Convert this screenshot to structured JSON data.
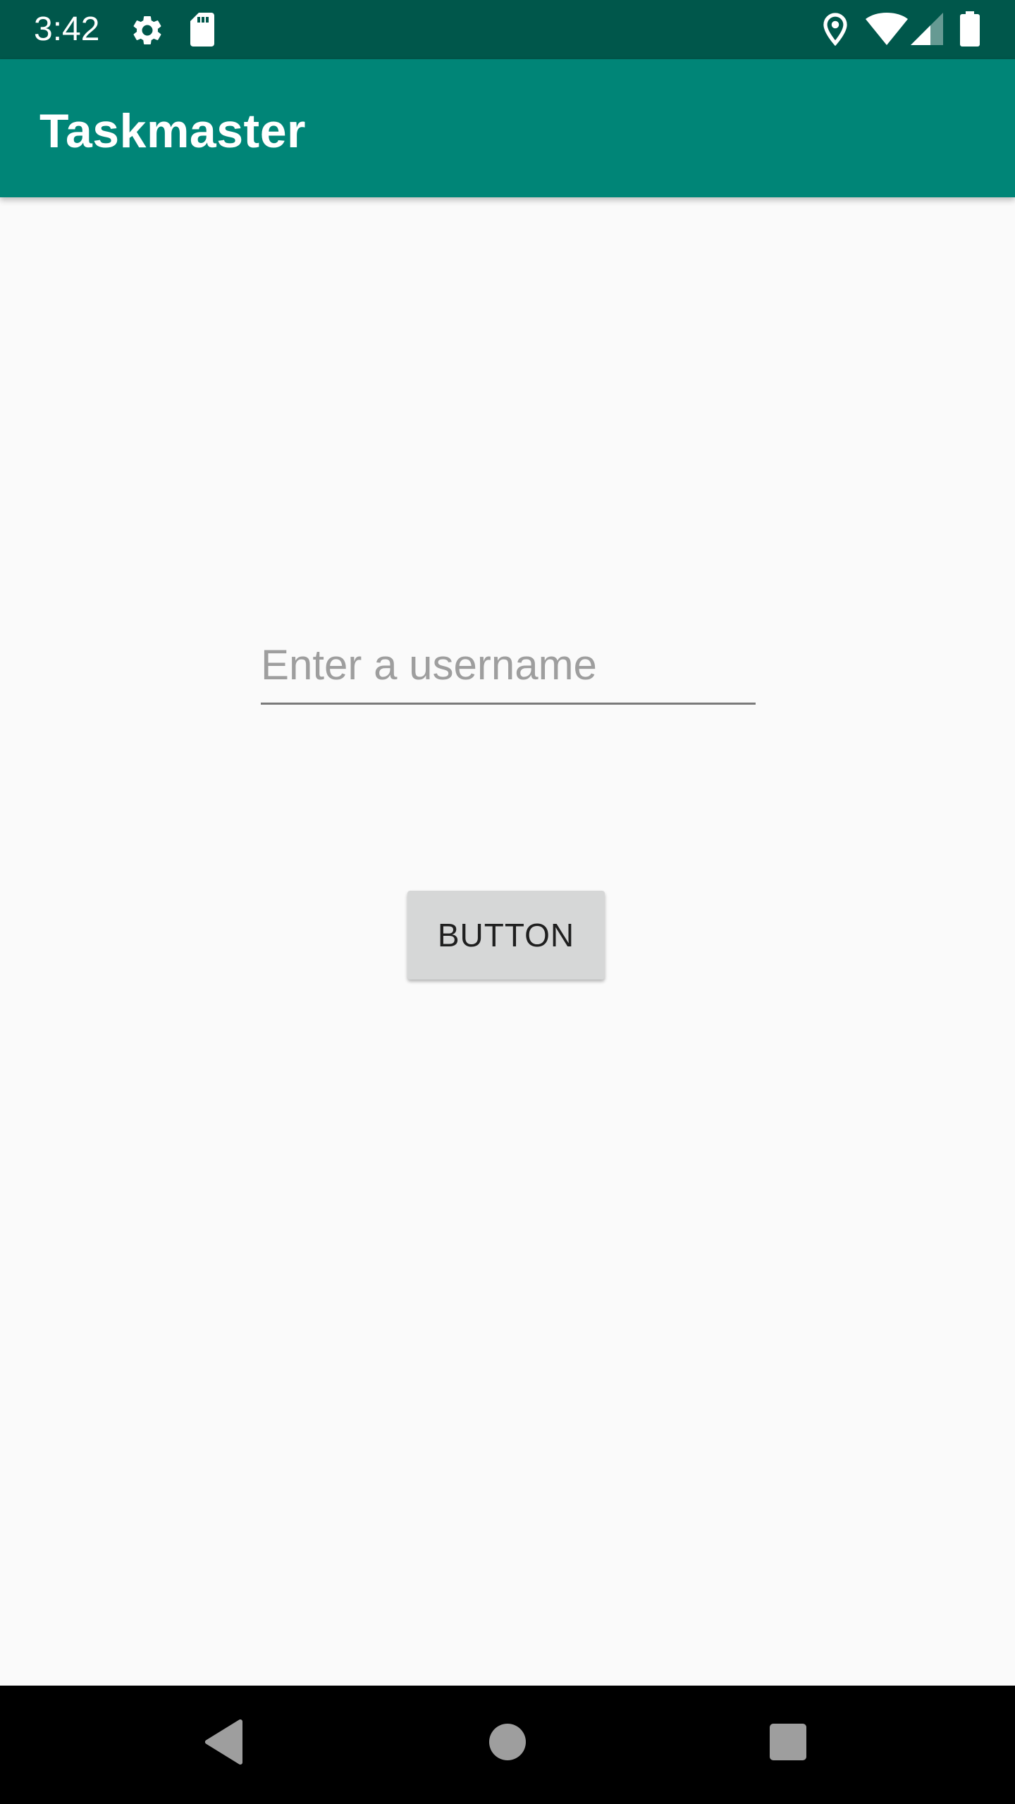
{
  "status_bar": {
    "time": "3:42",
    "icons": [
      "gear-icon",
      "sd-card-icon",
      "location-icon",
      "wifi-icon",
      "cell-signal-icon",
      "battery-icon"
    ],
    "background": "#00574b"
  },
  "app_bar": {
    "title": "Taskmaster",
    "background": "#008577"
  },
  "main": {
    "username_input": {
      "value": "",
      "placeholder": "Enter a username"
    },
    "button_label": "BUTTON"
  },
  "nav_bar": {
    "icons": [
      "back-icon",
      "home-icon",
      "recents-icon"
    ]
  }
}
